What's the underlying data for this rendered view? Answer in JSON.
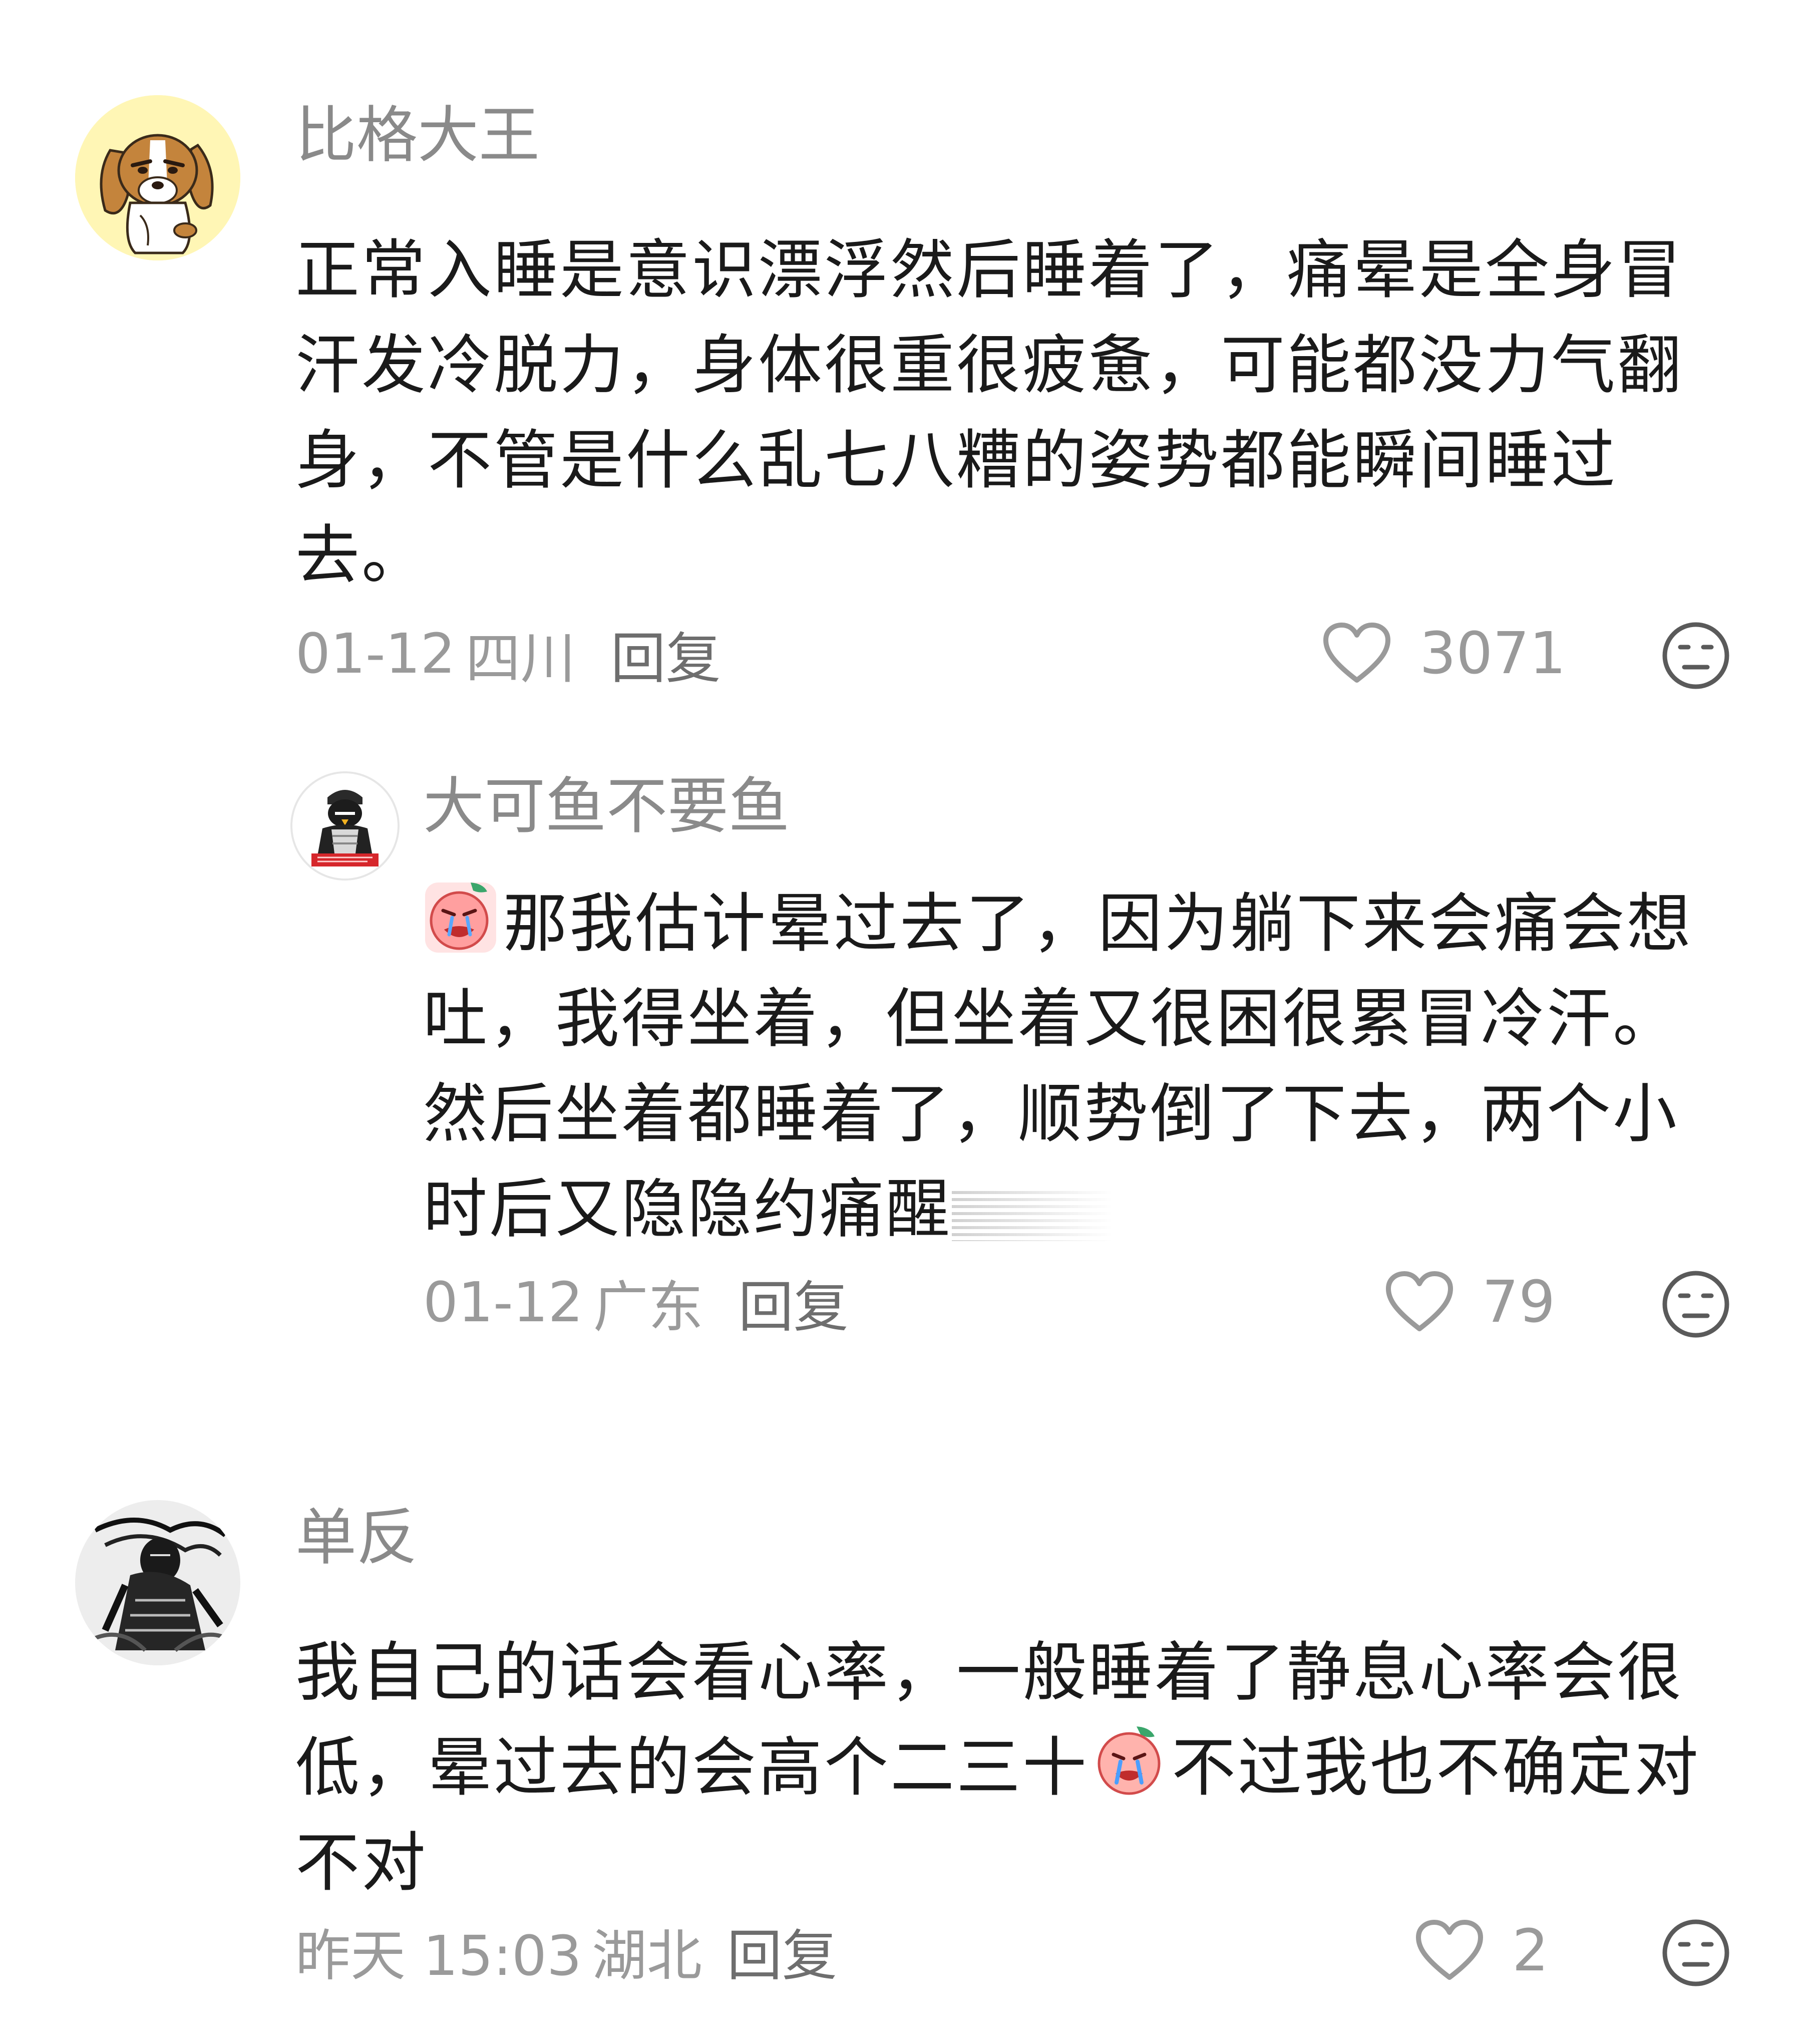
{
  "comments": [
    {
      "username": "比格大王",
      "avatar_icon": "beagle-dog-avatar-icon",
      "text": "正常入睡是意识漂浮然后睡着了，痛晕是全身冒汗发冷脱力，身体很重很疲惫，可能都没力气翻身，不管是什么乱七八糟的姿势都能瞬间睡过去。",
      "date": "01-12",
      "location": "四川",
      "reply_label": "回复",
      "likes": "3071"
    },
    {
      "username": "大可鱼不要鱼",
      "avatar_icon": "penguin-character-avatar-icon",
      "avatar_badge_color": "#d6262b",
      "emoji_icon": "crying-peach-emoji-icon",
      "text": "那我估计晕过去了，因为躺下来会痛会想吐，我得坐着，但坐着又很困很累冒冷汗。然后坐着都睡着了，顺势倒了下去，两个小时后又隐隐约痛醒",
      "date": "01-12",
      "location": "广东",
      "reply_label": "回复",
      "likes": "79"
    },
    {
      "username": "单反",
      "avatar_icon": "ink-warrior-avatar-icon",
      "text_before_emoji": "我自己的话会看心率，一般睡着了静息心率会很低，晕过去的会高个二三十",
      "emoji_icon": "crying-peach-emoji-icon",
      "text_after_emoji": "不过我也不确定对不对",
      "date": "昨天 15:03",
      "location": "湖北",
      "reply_label": "回复",
      "likes": "2"
    }
  ],
  "icons": {
    "like": "heart-outline-icon",
    "dislike": "neutral-face-icon"
  },
  "colors": {
    "username": "#8a8a8a",
    "body_text": "#1a1a1a",
    "meta": "#9a9a9a",
    "avatar_yellow": "#fff3a6"
  }
}
